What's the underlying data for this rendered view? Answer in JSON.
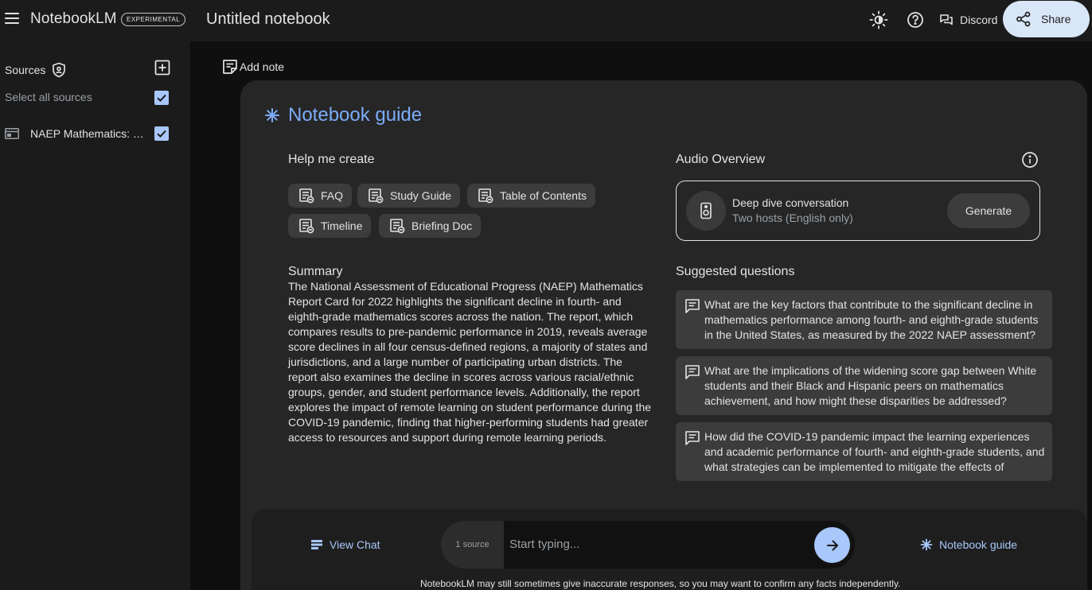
{
  "app": {
    "name": "NotebookLM",
    "badge": "EXPERIMENTAL",
    "notebook_title": "Untitled notebook"
  },
  "header": {
    "discord_label": "Discord",
    "share_label": "Share",
    "icons": [
      "menu-icon",
      "theme-toggle-icon",
      "help-icon",
      "discord-chat-icon",
      "share-icon"
    ]
  },
  "sidebar": {
    "title": "Sources",
    "select_all_label": "Select all sources",
    "select_all_checked": true,
    "sources": [
      {
        "name": "NAEP Mathematics: M...",
        "checked": true
      }
    ]
  },
  "main": {
    "add_note_label": "Add note"
  },
  "guide": {
    "title": "Notebook guide",
    "help_heading": "Help me create",
    "chips": [
      {
        "label": "FAQ"
      },
      {
        "label": "Study Guide"
      },
      {
        "label": "Table of Contents"
      },
      {
        "label": "Timeline"
      },
      {
        "label": "Briefing Doc"
      }
    ],
    "summary_heading": "Summary",
    "summary": "The National Assessment of Educational Progress (NAEP) Mathematics Report Card for 2022 highlights the significant decline in fourth- and eighth-grade mathematics scores across the nation. The report, which compares results to pre-pandemic performance in 2019, reveals average score declines in all four census-defined regions, a majority of states and jurisdictions, and a large number of participating urban districts. The report also examines the decline in scores across various racial/ethnic groups, gender, and student performance levels. Additionally, the report explores the impact of remote learning on student performance during the COVID-19 pandemic, finding that higher-performing students had greater access to resources and support during remote learning periods.",
    "audio_heading": "Audio Overview",
    "audio_title": "Deep dive conversation",
    "audio_subtitle": "Two hosts (English only)",
    "generate_label": "Generate",
    "suggested_heading": "Suggested questions",
    "questions": [
      "What are the key factors that contribute to the significant decline in mathematics performance among fourth- and eighth-grade students in the United States, as measured by the 2022 NAEP assessment?",
      "What are the implications of the widening score gap between White students and their Black and Hispanic peers on mathematics achievement, and how might these disparities be addressed?",
      "How did the COVID-19 pandemic impact the learning experiences and academic performance of fourth- and eighth-grade students, and what strategies can be implemented to mitigate the effects of"
    ]
  },
  "chat_bar": {
    "view_chat_label": "View Chat",
    "source_count": "1 source",
    "placeholder": "Start typing...",
    "guide_label": "Notebook guide",
    "disclaimer": "NotebookLM may still sometimes give inaccurate responses, so you may want to confirm any facts independently."
  },
  "colors": {
    "accent": "#7cacf8",
    "link": "#a8c7fa",
    "share_bg": "#d9e6f7",
    "panel_bg": "#262626",
    "chip_bg": "#3c3c3c"
  }
}
